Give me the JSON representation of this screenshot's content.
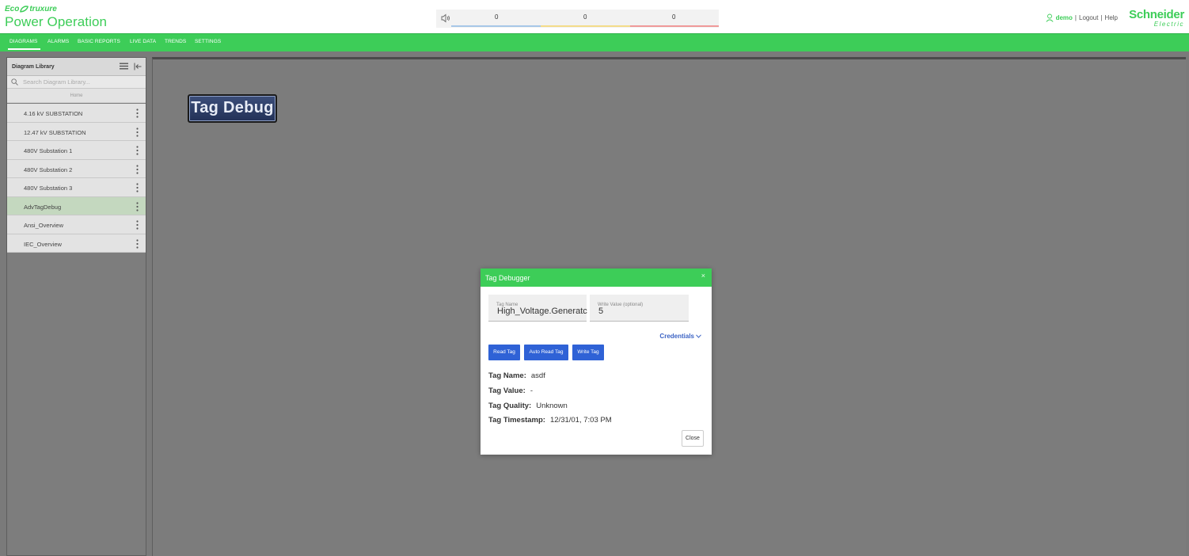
{
  "header": {
    "brand_top": "Eco truxure",
    "brand_title": "Power Operation",
    "alarm_counts": [
      "0",
      "0",
      "0"
    ],
    "alarm_colors": [
      "#a7c7e7",
      "#f4dc8a",
      "#ef9a9a"
    ],
    "user_name": "demo",
    "logout_label": "Logout",
    "help_label": "Help",
    "logo_line1": "Schneider",
    "logo_line2": "Electric"
  },
  "nav": {
    "items": [
      "DIAGRAMS",
      "ALARMS",
      "BASIC REPORTS",
      "LIVE DATA",
      "TRENDS",
      "SETTINGS"
    ],
    "active": "DIAGRAMS"
  },
  "sidebar": {
    "title": "Diagram Library",
    "search_placeholder": "Search Diagram Library...",
    "home_label": "Home",
    "items": [
      {
        "label": "4.16 kV SUBSTATION"
      },
      {
        "label": "12.47 kV SUBSTATION"
      },
      {
        "label": "480V Substation 1"
      },
      {
        "label": "480V Substation 2"
      },
      {
        "label": "480V Substation 3"
      },
      {
        "label": "AdvTagDebug",
        "active": true
      },
      {
        "label": "Ansi_Overview"
      },
      {
        "label": "IEC_Overview"
      }
    ]
  },
  "canvas": {
    "tag_debug_button": "Tag Debug"
  },
  "dialog": {
    "title": "Tag Debugger",
    "close_x": "×",
    "tag_name_label": "Tag Name",
    "tag_name_value": "High_Voltage.Generatc",
    "write_value_label": "Write Value (optional)",
    "write_value_value": "5",
    "credentials_label": "Credentials",
    "read_tag": "Read Tag",
    "auto_read_tag": "Auto Read Tag",
    "write_tag": "Write Tag",
    "info": {
      "name_key": "Tag Name:",
      "name_val": "asdf",
      "value_key": "Tag Value:",
      "value_val": "-",
      "quality_key": "Tag Quality:",
      "quality_val": "Unknown",
      "timestamp_key": "Tag Timestamp:",
      "timestamp_val": "12/31/01, 7:03 PM"
    },
    "close_button": "Close"
  }
}
